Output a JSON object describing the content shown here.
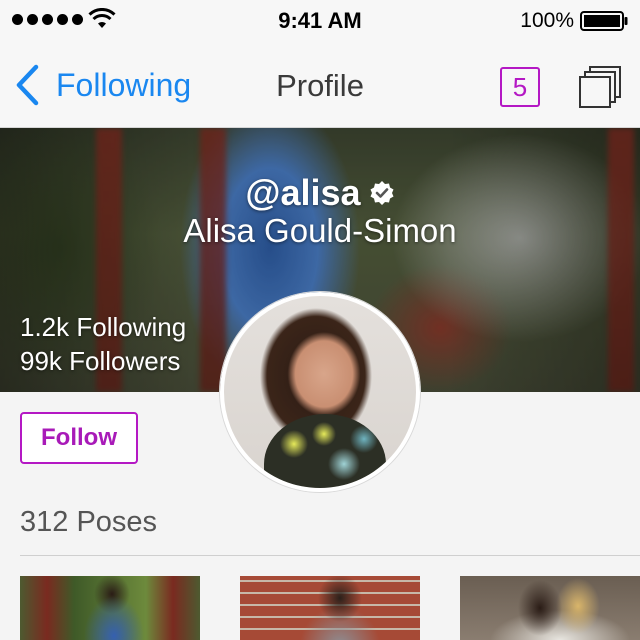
{
  "status_bar": {
    "time": "9:41 AM",
    "battery_percent": "100%",
    "signal_bars": 5,
    "icons": [
      "signal-dots-icon",
      "wifi-icon",
      "battery-icon"
    ]
  },
  "nav": {
    "back_label": "Following",
    "title": "Profile",
    "badge_count": "5",
    "icons": [
      "chevron-left-icon",
      "stack-icon"
    ]
  },
  "profile": {
    "handle": "@alisa",
    "verified": true,
    "display_name": "Alisa Gould-Simon",
    "following": "1.2k Following",
    "followers": "99k Followers",
    "follow_label": "Follow"
  },
  "poses": {
    "count_label": "312 Poses",
    "thumbnails": [
      "pose-thumbnail",
      "pose-thumbnail",
      "pose-thumbnail"
    ]
  },
  "colors": {
    "accent_blue": "#1a87f0",
    "accent_purple": "#b418c4",
    "background": "#f4f4f4"
  }
}
